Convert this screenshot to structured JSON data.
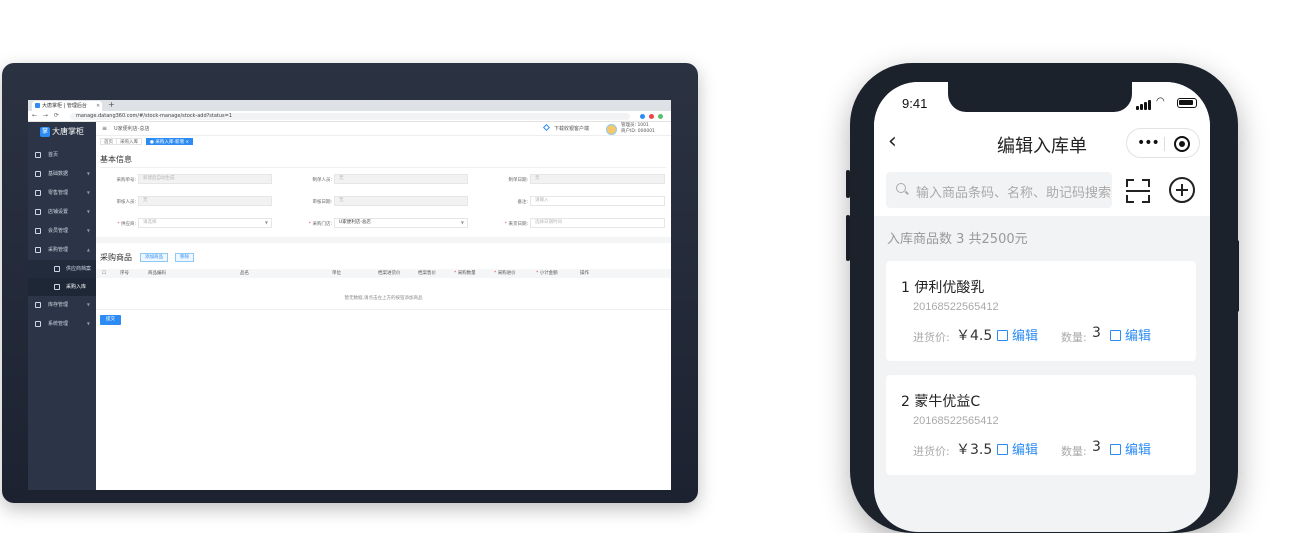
{
  "desktop": {
    "browser": {
      "tab_title": "大唐掌柜 | 管理后台",
      "tab_close": "×",
      "new_tab": "+",
      "nav_buttons": "← → ⟳",
      "url": "manage.datang360.com/#/stock-manage/stock-add?status=1"
    },
    "logo_text": "大唐掌柜",
    "sidebar": [
      {
        "label": "首页"
      },
      {
        "label": "基础数据"
      },
      {
        "label": "零售管理"
      },
      {
        "label": "店铺设置"
      },
      {
        "label": "会员管理"
      },
      {
        "label": "采购管理"
      },
      {
        "label": "供应商档案"
      },
      {
        "label": "采购入库"
      },
      {
        "label": "库存管理"
      },
      {
        "label": "系统管理"
      }
    ],
    "topbar": {
      "menu_icon": "≡",
      "store": "U家便利店-总店",
      "download": "下载收银客户端",
      "account_line1": "管理员: 1001",
      "account_line2": "商户ID: 000001"
    },
    "breadcrumbs": [
      "首页",
      "采购入库",
      "● 采购入库-新增 ×"
    ],
    "basic_title": "基本信息",
    "fields": {
      "order_no": {
        "label": "采购单号:",
        "value": "新建后自动生成"
      },
      "maker": {
        "label": "制单人员:",
        "value": "无"
      },
      "make_date": {
        "label": "制单日期:",
        "value": "无"
      },
      "auditor": {
        "label": "审核人员:",
        "value": "无"
      },
      "audit_date": {
        "label": "审核日期:",
        "value": "无"
      },
      "remark": {
        "label": "备注:",
        "value": "请输入"
      },
      "supplier": {
        "label": "供应商:",
        "value": "请选择"
      },
      "store": {
        "label": "采购门店:",
        "value": "U家便利店-总店"
      },
      "arrival": {
        "label": "来货日期:",
        "value": "选择日期时间"
      }
    },
    "goods_title": "采购商品",
    "buttons": {
      "add": "添加商品",
      "remove": "移除",
      "submit": "提交"
    },
    "table_headers": [
      "序号",
      "商品编码",
      "品名",
      "单位",
      "档案进货价",
      "档案售价",
      "采购数量",
      "采购进价",
      "小计金额",
      "操作"
    ],
    "empty_text": "暂无数据,请点击左上方的按钮添加商品"
  },
  "phone": {
    "time": "9:41",
    "title": "编辑入库单",
    "back_icon": "‹",
    "more_icon": "•••",
    "search_placeholder": "输入商品条码、名称、助记码搜索",
    "summary": "入库商品数 3   共2500元",
    "items": [
      {
        "name": "1 伊利优酸乳",
        "code": "20168522565412",
        "price_label": "进货价:",
        "price": "￥4.5",
        "edit": "编辑",
        "qty_label": "数量:",
        "qty": "3"
      },
      {
        "name": "2 蒙牛优益C",
        "code": "20168522565412",
        "price_label": "进货价:",
        "price": "￥3.5",
        "edit": "编辑",
        "qty_label": "数量:",
        "qty": "3"
      }
    ]
  },
  "colors": {
    "accent": "#2c8cf4",
    "sidebar": "#2b3547",
    "device": "#1c222c"
  }
}
